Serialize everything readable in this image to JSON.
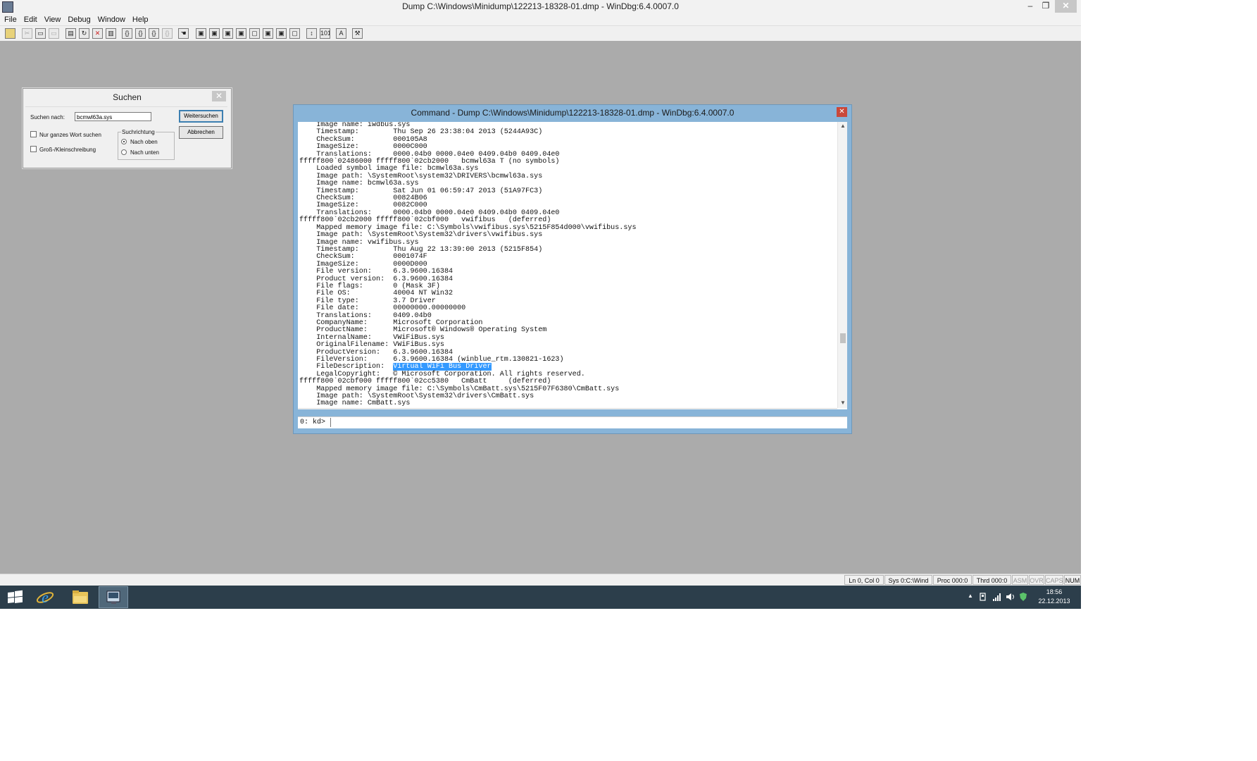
{
  "window": {
    "title": "Dump C:\\Windows\\Minidump\\122213-18328-01.dmp - WinDbg:6.4.0007.0",
    "minimize": "–",
    "restore": "❐",
    "close": "✕"
  },
  "menu": [
    "File",
    "Edit",
    "View",
    "Debug",
    "Window",
    "Help"
  ],
  "find_dialog": {
    "title": "Suchen",
    "close": "✕",
    "search_label": "Suchen nach:",
    "search_value": "bcmwl63a.sys",
    "find_next": "Weitersuchen",
    "cancel": "Abbrechen",
    "whole_word": "Nur ganzes Wort suchen",
    "match_case": "Groß-/Kleinschreibung",
    "direction_label": "Suchrichtung",
    "direction_up": "Nach oben",
    "direction_down": "Nach unten",
    "direction_selected": "up"
  },
  "command_window": {
    "title": "Command - Dump C:\\Windows\\Minidump\\122213-18328-01.dmp - WinDbg:6.4.0007.0",
    "close": "✕",
    "output": {
      "before": "    Image name: iwdbus.sys\n    Timestamp:        Thu Sep 26 23:38:04 2013 (5244A93C)\n    CheckSum:         000105A8\n    ImageSize:        0000C000\n    Translations:     0000.04b0 0000.04e0 0409.04b0 0409.04e0\nfffff800`02486000 fffff800`02cb2000   bcmwl63a T (no symbols)\n    Loaded symbol image file: bcmwl63a.sys\n    Image path: \\SystemRoot\\system32\\DRIVERS\\bcmwl63a.sys\n    Image name: bcmwl63a.sys\n    Timestamp:        Sat Jun 01 06:59:47 2013 (51A97FC3)\n    CheckSum:         00824B06\n    ImageSize:        0082C000\n    Translations:     0000.04b0 0000.04e0 0409.04b0 0409.04e0\nfffff800`02cb2000 fffff800`02cbf000   vwifibus   (deferred)\n    Mapped memory image file: C:\\Symbols\\vwifibus.sys\\5215F854d000\\vwifibus.sys\n    Image path: \\SystemRoot\\System32\\drivers\\vwifibus.sys\n    Image name: vwifibus.sys\n    Timestamp:        Thu Aug 22 13:39:00 2013 (5215F854)\n    CheckSum:         0001074F\n    ImageSize:        0000D000\n    File version:     6.3.9600.16384\n    Product version:  6.3.9600.16384\n    File flags:       0 (Mask 3F)\n    File OS:          40004 NT Win32\n    File type:        3.7 Driver\n    File date:        00000000.00000000\n    Translations:     0409.04b0\n    CompanyName:      Microsoft Corporation\n    ProductName:      Microsoft® Windows® Operating System\n    InternalName:     VWiFiBus.sys\n    OriginalFilename: VWiFiBus.sys\n    ProductVersion:   6.3.9600.16384\n    FileVersion:      6.3.9600.16384 (winblue_rtm.130821-1623)\n    FileDescription:  ",
      "highlight": "Virtual WiFi Bus Driver",
      "after": "\n    LegalCopyright:   © Microsoft Corporation. All rights reserved.\nfffff800`02cbf000 fffff800`02cc5380   CmBatt     (deferred)\n    Mapped memory image file: C:\\Symbols\\CmBatt.sys\\5215F07F6380\\CmBatt.sys\n    Image path: \\SystemRoot\\System32\\drivers\\CmBatt.sys\n    Image name: CmBatt.sys"
    },
    "prompt": "0: kd>",
    "input_value": ""
  },
  "statusbar": {
    "position": "Ln 0, Col 0",
    "sys": "Sys 0:C:\\Wind",
    "proc": "Proc 000:0",
    "thrd": "Thrd 000:0",
    "asm": "ASM",
    "ovr": "OVR",
    "caps": "CAPS",
    "num": "NUM"
  },
  "taskbar": {
    "time": "18:56",
    "date": "22.12.2013",
    "tray_expand": "▲"
  },
  "colors": {
    "desktop_mdi": "#ababab",
    "command_frame": "#88b4d8",
    "highlight": "#3399ff",
    "taskbar": "#2c3e4b",
    "close_button": "#c9483a"
  }
}
